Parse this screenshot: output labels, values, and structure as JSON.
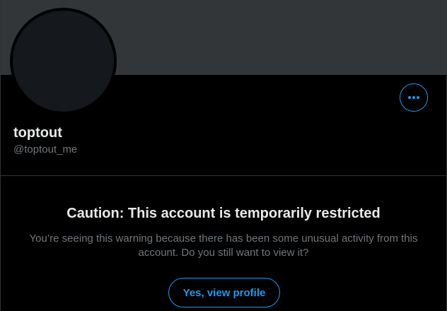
{
  "profile": {
    "display_name": "toptout",
    "handle": "@toptout_me"
  },
  "more_button": {
    "icon": "more-horizontal-icon"
  },
  "warning": {
    "title": "Caution: This account is temporarily restricted",
    "body": "You’re seeing this warning because there has been some unusual activity from this account. Do you still want to view it?",
    "action_label": "Yes, view profile"
  },
  "colors": {
    "background": "#000000",
    "banner": "#333639",
    "accent": "#1d9bf0",
    "primary_text": "#e7e9ea",
    "secondary_text": "#71767b",
    "border": "#2f3336"
  }
}
